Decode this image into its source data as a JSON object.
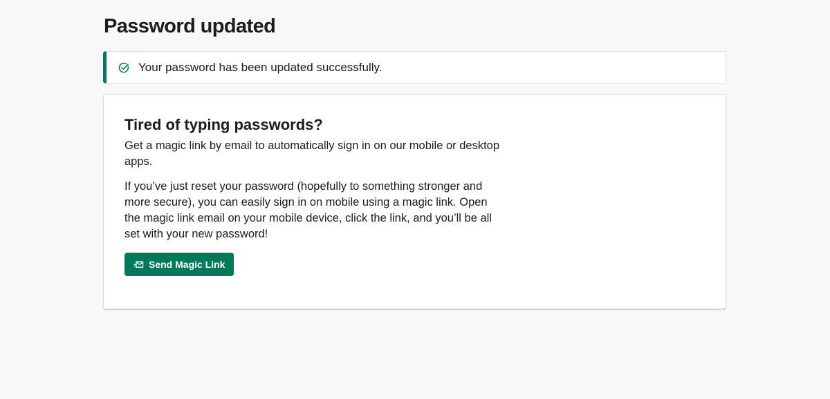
{
  "page": {
    "title": "Password updated"
  },
  "alert": {
    "icon": "check-circle-icon",
    "message": "Your password has been updated successfully.",
    "accent_color": "#007a5a"
  },
  "card": {
    "heading": "Tired of typing passwords?",
    "intro": "Get a magic link by email to automatically sign in on our mobile or desktop apps.",
    "details": "If you’ve just reset your password (hopefully to something stronger and more secure), you can easily sign in on mobile using a magic link. Open the magic link email on your mobile device, click the link, and you’ll be all set with your new password!",
    "button": {
      "label": "Send Magic Link",
      "icon": "mail-send-icon",
      "color": "#007a5a"
    }
  }
}
